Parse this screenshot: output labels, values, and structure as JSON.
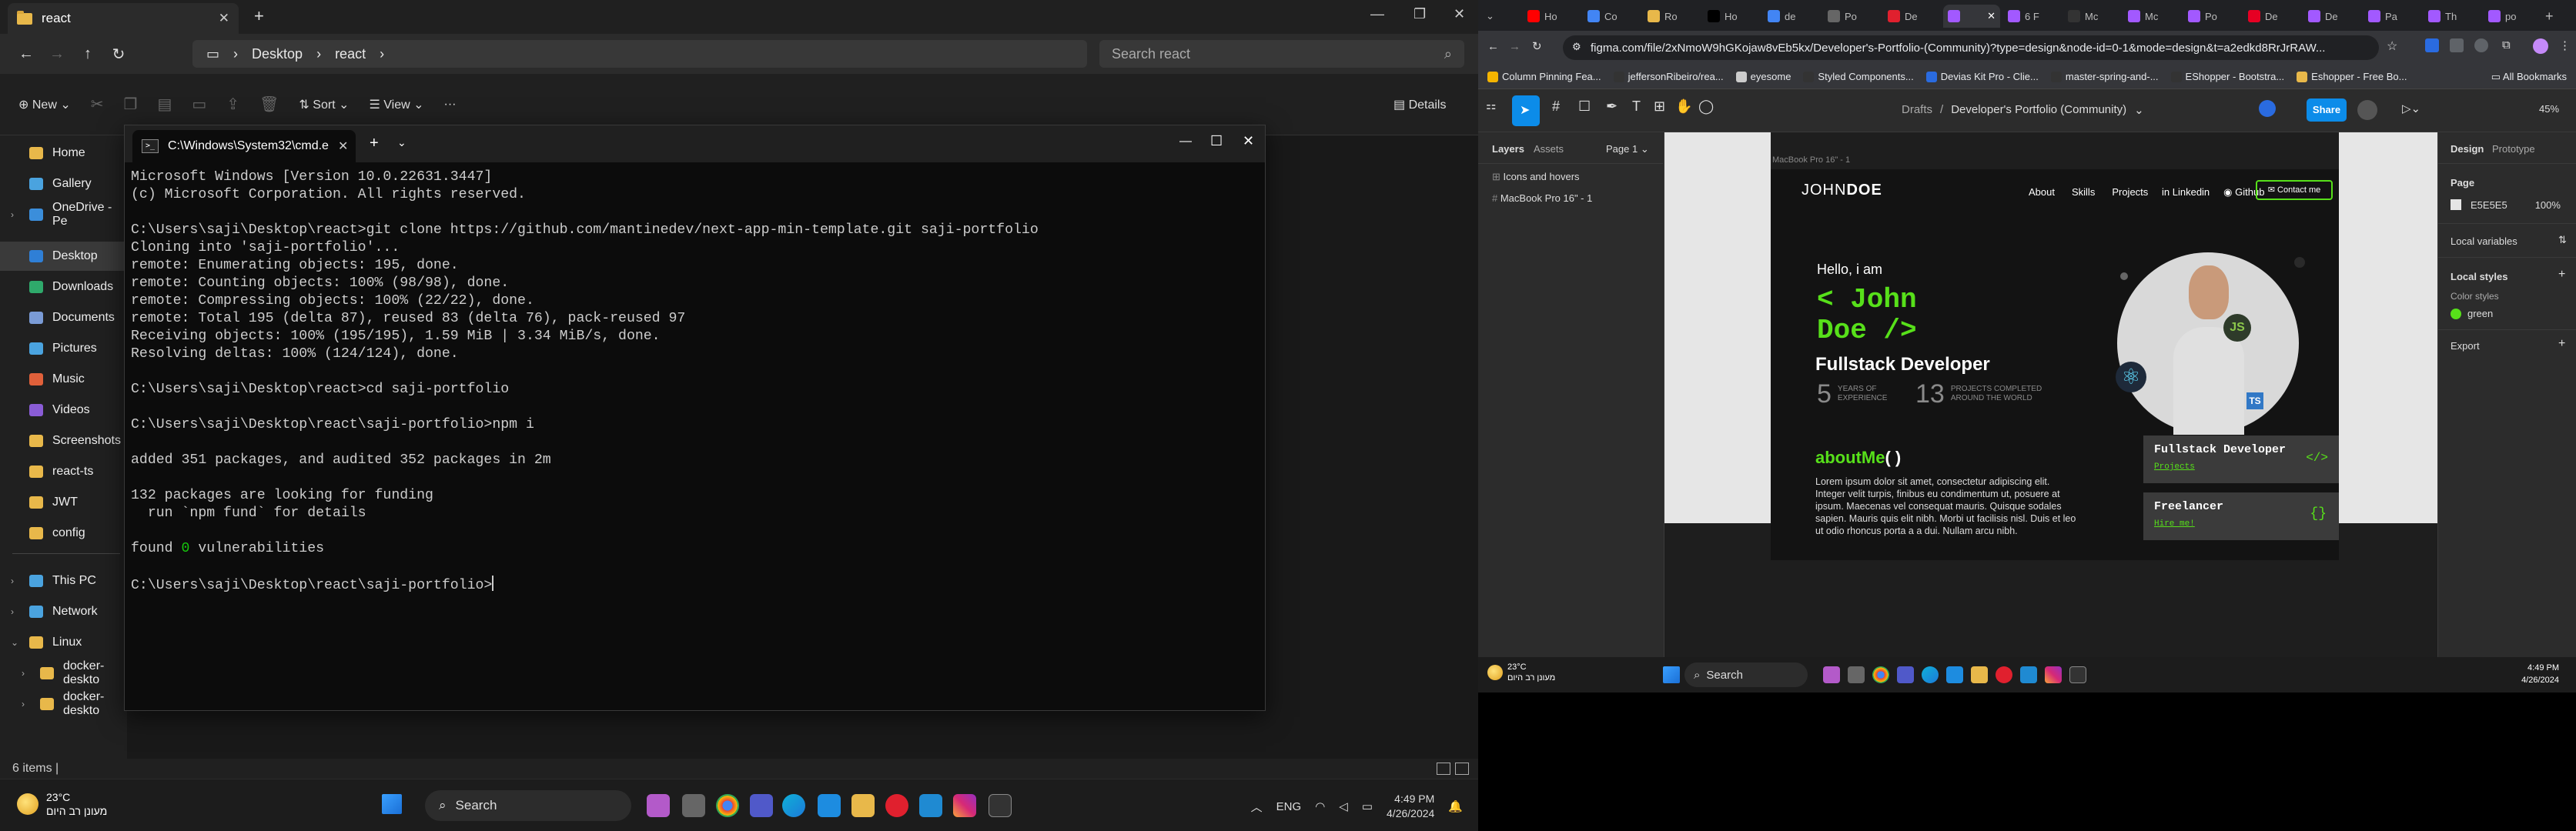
{
  "explorer": {
    "tab_title": "react",
    "breadcrumb": [
      "Desktop",
      "react"
    ],
    "search_placeholder": "Search react",
    "commands": {
      "new": "New",
      "sort": "Sort",
      "view": "View",
      "details": "Details"
    },
    "sidebar": [
      {
        "label": "Home",
        "color": "#e8b84a"
      },
      {
        "label": "Gallery",
        "color": "#4aa3df"
      },
      {
        "label": "OneDrive - Pe",
        "color": "#3b8edb"
      },
      {
        "label": "Desktop",
        "color": "#2f7fd6"
      },
      {
        "label": "Downloads",
        "color": "#2fa96b"
      },
      {
        "label": "Documents",
        "color": "#7a9bd6"
      },
      {
        "label": "Pictures",
        "color": "#4aa3df"
      },
      {
        "label": "Music",
        "color": "#e0603a"
      },
      {
        "label": "Videos",
        "color": "#8a5cd6"
      },
      {
        "label": "Screenshots",
        "color": "#e8b84a"
      },
      {
        "label": "react-ts",
        "color": "#e8b84a"
      },
      {
        "label": "JWT",
        "color": "#e8b84a"
      },
      {
        "label": "config",
        "color": "#e8b84a"
      },
      {
        "label": "This PC",
        "color": "#4aa3df"
      },
      {
        "label": "Network",
        "color": "#4aa3df"
      },
      {
        "label": "Linux",
        "color": "#e8b84a"
      },
      {
        "label": "docker-deskto",
        "color": "#e8b84a"
      },
      {
        "label": "docker-deskto",
        "color": "#e8b84a"
      }
    ],
    "status": "6 items  |"
  },
  "cmd": {
    "tab_title": "C:\\Windows\\System32\\cmd.e",
    "lines": [
      "Microsoft Windows [Version 10.0.22631.3447]",
      "(c) Microsoft Corporation. All rights reserved.",
      "",
      "C:\\Users\\saji\\Desktop\\react>git clone https://github.com/mantinedev/next-app-min-template.git saji-portfolio",
      "Cloning into 'saji-portfolio'...",
      "remote: Enumerating objects: 195, done.",
      "remote: Counting objects: 100% (98/98), done.",
      "remote: Compressing objects: 100% (22/22), done.",
      "remote: Total 195 (delta 87), reused 83 (delta 76), pack-reused 97",
      "Receiving objects: 100% (195/195), 1.59 MiB | 3.34 MiB/s, done.",
      "Resolving deltas: 100% (124/124), done.",
      "",
      "C:\\Users\\saji\\Desktop\\react>cd saji-portfolio",
      "",
      "C:\\Users\\saji\\Desktop\\react\\saji-portfolio>npm i",
      "",
      "added 351 packages, and audited 352 packages in 2m",
      "",
      "132 packages are looking for funding",
      "  run `npm fund` for details",
      ""
    ],
    "found_prefix": "found ",
    "found_count": "0",
    "found_suffix": " vulnerabilities",
    "prompt": "C:\\Users\\saji\\Desktop\\react\\saji-portfolio>"
  },
  "taskbar": {
    "temp": "23°C",
    "weather_text": "מעונן רב היום",
    "search": "Search",
    "lang": "ENG",
    "time": "4:49 PM",
    "date": "4/26/2024"
  },
  "chrome": {
    "tabs": [
      "Ho",
      "Co",
      "Ro",
      "Ho",
      "de",
      "Po",
      "De",
      "",
      "6 F",
      "Mc",
      "Mc",
      "Po",
      "De",
      "De",
      "Pa",
      "Th",
      "po"
    ],
    "url": "figma.com/file/2xNmoW9hGKojaw8vEb5kx/Developer's-Portfolio-(Community)?type=design&node-id=0-1&mode=design&t=a2edkd8RrJrRAW...",
    "bookmarks": [
      "Column Pinning Fea...",
      "jeffersonRibeiro/rea...",
      "eyesome",
      "Styled Components...",
      "Devias Kit Pro - Clie...",
      "master-spring-and-...",
      "EShopper - Bootstra...",
      "Eshopper - Free Bo..."
    ],
    "all_bookmarks": "All Bookmarks"
  },
  "figma": {
    "drafts": "Drafts",
    "file_name": "Developer's Portfolio (Community)",
    "share": "Share",
    "zoom": "45%",
    "tabs": {
      "layers": "Layers",
      "assets": "Assets",
      "page": "Page 1"
    },
    "layers": [
      "Icons and hovers",
      "MacBook Pro 16\" - 1"
    ],
    "frame_label": "MacBook Pro 16\" - 1",
    "right_tabs": {
      "design": "Design",
      "prototype": "Prototype"
    },
    "page_label": "Page",
    "page_color": "E5E5E5",
    "page_opacity": "100%",
    "local_variables": "Local variables",
    "local_styles": "Local styles",
    "color_styles": "Color styles",
    "style_green": "green",
    "export": "Export"
  },
  "design": {
    "logo_first": "JOHN",
    "logo_second": "DOE",
    "nav": [
      "About",
      "Skills",
      "Projects"
    ],
    "linkedin": "Linkedin",
    "github": "Github",
    "contact": "Contact me",
    "hello": "Hello, i am",
    "name_line1": "< John",
    "name_line2": "Doe />",
    "role": "Fullstack Developer",
    "years_num": "5",
    "years_text": "YEARS OF EXPERIENCE",
    "projects_num": "13",
    "projects_text": "PROJECTS COMPLETED AROUND THE WORLD",
    "about_title": "aboutMe",
    "about_parens": "( )",
    "lorem": "Lorem ipsum dolor sit amet, consectetur adipiscing elit. Integer velit turpis, finibus eu condimentum ut, posuere at ipsum. Maecenas vel consequat mauris. Quisque sodales sapien. Mauris quis elit nibh. Morbi ut facilisis nisl. Duis et leo ut odio rhoncus porta a a dui. Nullam arcu nibh.",
    "card1_title": "Fullstack Developer",
    "card1_link": "Projects",
    "card2_title": "Freelancer",
    "card2_link": "Hire me!"
  },
  "right_taskbar": {
    "temp": "23°C",
    "weather_text": "מעונן רב היום",
    "search": "Search",
    "time": "4:49 PM",
    "date": "4/26/2024"
  }
}
